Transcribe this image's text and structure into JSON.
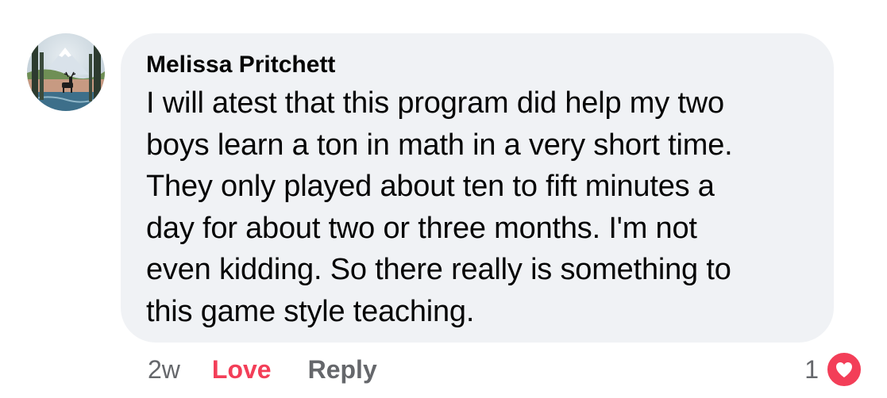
{
  "comment": {
    "author": "Melissa Pritchett",
    "lines": [
      "I will atest that this program did help my two",
      "boys learn a ton in math in a very short time.",
      "They only played about ten to fift minutes a",
      "day for about two or three months. I'm not",
      "even kidding. So there really is something to",
      "this game style teaching."
    ]
  },
  "actions": {
    "timestamp": "2w",
    "love_label": "Love",
    "reply_label": "Reply"
  },
  "reactions": {
    "count": "1",
    "icon": "heart-icon"
  },
  "colors": {
    "bubble": "#f0f2f5",
    "love": "#f33e58",
    "muted": "#65676b",
    "text": "#050505"
  }
}
